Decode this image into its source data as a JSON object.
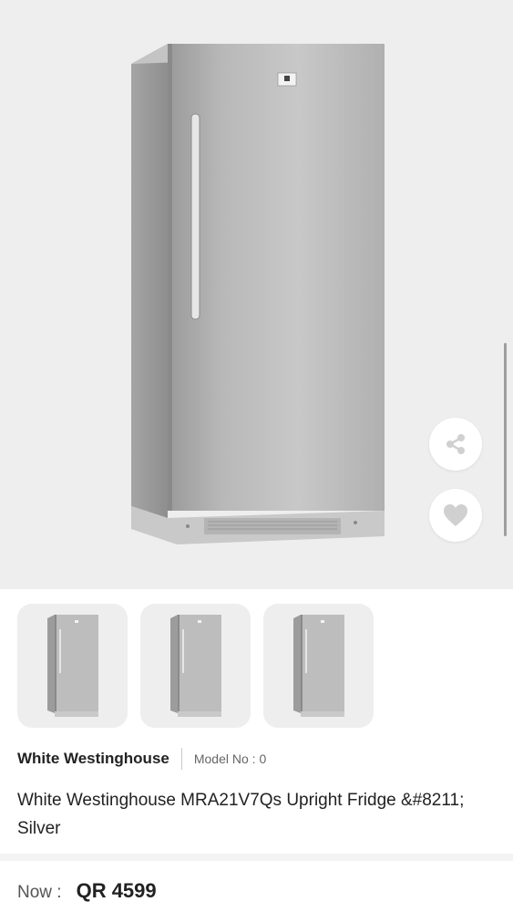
{
  "product": {
    "brand": "White Westinghouse",
    "model_label": "Model No : 0",
    "title": "White Westinghouse MRA21V7Qs Upright Fridge &#8211; Silver",
    "price_label": "Now :",
    "price_value": "QR 4599"
  },
  "gallery": {
    "thumbnail_count": 3,
    "scroll_position": 0.6
  },
  "actions": {
    "share_icon": "share-icon",
    "favorite_icon": "heart-icon"
  },
  "colors": {
    "hero_background": "#eeeeee",
    "action_button": "#ffffff",
    "icon_gray": "#d0d0d0"
  }
}
